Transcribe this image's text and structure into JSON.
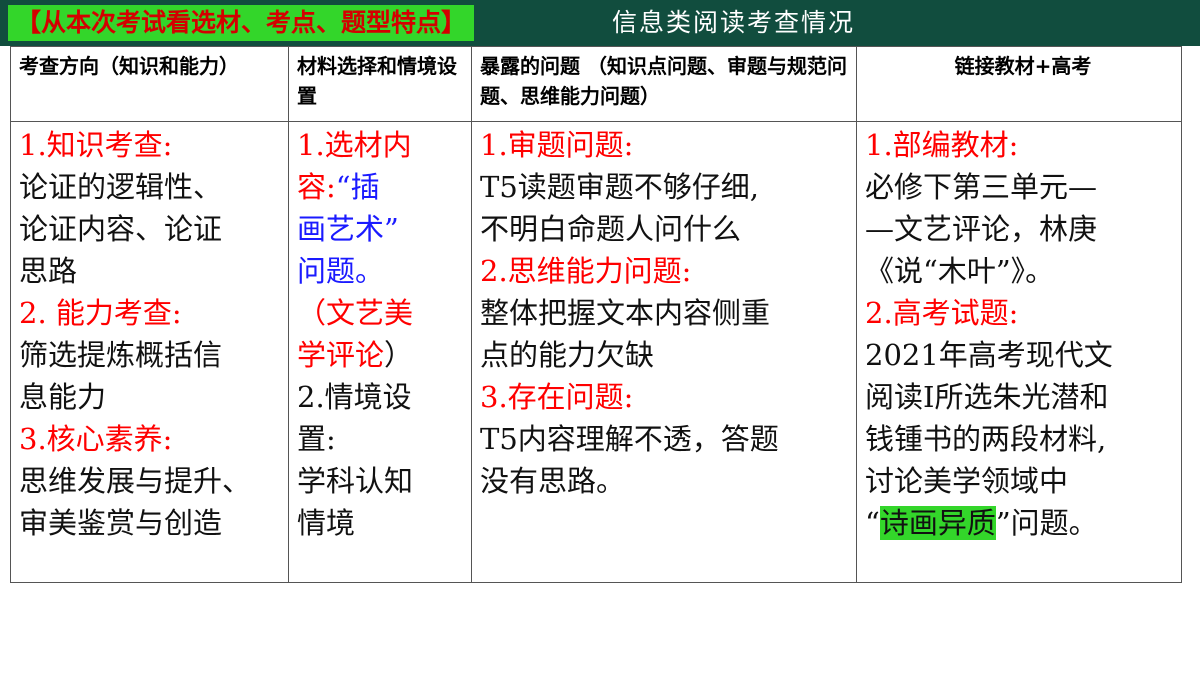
{
  "header": {
    "badge": "【从本次考试看选材、考点、题型特点】",
    "title": "信息类阅读考查情况"
  },
  "columns": [
    "考查方向（知识和能力）",
    "材料选择和情境设置",
    "暴露的问题 （知识点问题、审题与规范问题、思维能力问题）",
    "链接教材+高考"
  ],
  "col1": {
    "h1": "1.知识考查:",
    "t1a": "论证的逻辑性、",
    "t1b": "论证内容、论证",
    "t1c": "思路",
    "h2": "2. 能力考查:",
    "t2a": "筛选提炼概括信",
    "t2b": "息能力",
    "h3": "3.核心素养:",
    "t3a": "思维发展与提升、",
    "t3b": "审美鉴赏与创造"
  },
  "col2": {
    "h1": "1.选材内",
    "l2a": "容:",
    "l2b": "“插",
    "l3": "画艺术”",
    "l4": "问题。",
    "l5": "（文艺美",
    "l6a": "学评论",
    "l6b": "）",
    "l7": "2.情境设",
    "l8": "置:",
    "l9": "学科认知",
    "l10": "情境"
  },
  "col3": {
    "h1": "1.审题问题:",
    "t1a": "T5读题审题不够仔细,",
    "t1b": "不明白命题人问什么",
    "h2": "2.思维能力问题:",
    "t2a": "整体把握文本内容侧重",
    "t2b": "点的能力欠缺",
    "h3": "3.存在问题:",
    "t3a": "T5内容理解不透，答题",
    "t3b": "没有思路。"
  },
  "col4": {
    "h1": "1.部编教材:",
    "t1a": "必修下第三单元—",
    "t1b": "—文艺评论，林庚",
    "t1c": "《说“木叶”》。",
    "h2": "2.高考试题:",
    "t2a": "2021年高考现代文",
    "t2b": "阅读I所选朱光潜和",
    "t2c": "钱锺书的两段材料,",
    "t2d": "讨论美学领域中",
    "t2e_pre": "“",
    "t2e_hl": "诗画异质",
    "t2e_post": "”问题。"
  },
  "colors": {
    "topbar": "#114d3e",
    "badge_bg": "#33d62a",
    "badge_text": "#d40000",
    "heading_red": "#ff0000",
    "accent_blue": "#1a1aff"
  }
}
